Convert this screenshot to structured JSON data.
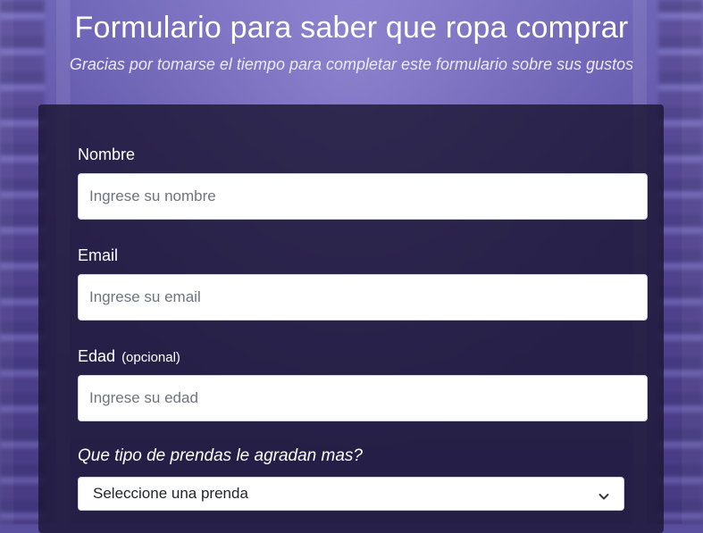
{
  "header": {
    "title": "Formulario para saber que ropa comprar",
    "subtitle": "Gracias por tomarse el tiempo para completar este formulario sobre sus gustos"
  },
  "form": {
    "name": {
      "label": "Nombre",
      "placeholder": "Ingrese su nombre"
    },
    "email": {
      "label": "Email",
      "placeholder": "Ingrese su email"
    },
    "age": {
      "label": "Edad",
      "optional_label": "(opcional)",
      "placeholder": "Ingrese su edad"
    },
    "garment_type": {
      "question": "Que tipo de prendas le agradan mas?",
      "selected": "Seleccione una prenda"
    }
  },
  "icons": {
    "select_chevron": "chevron-down-icon"
  }
}
